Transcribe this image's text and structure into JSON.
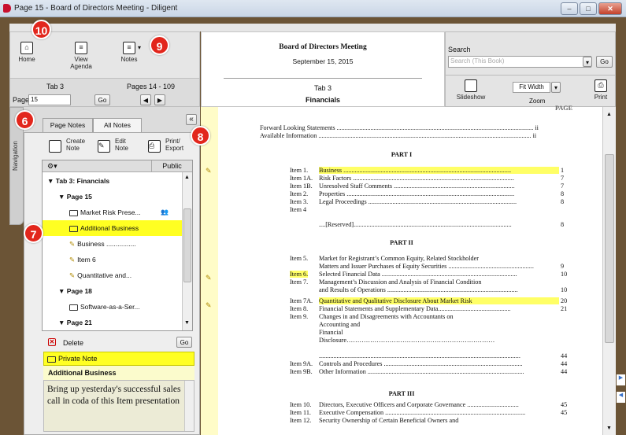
{
  "window": {
    "title": "Page 15 - Board of Directors Meeting - Diligent",
    "controls": [
      "–",
      "□",
      "✕"
    ]
  },
  "toolbar": {
    "home": "Home",
    "view_agenda_1": "View",
    "view_agenda_2": "Agenda",
    "notes": "Notes"
  },
  "nav": {
    "tab": "Tab 3",
    "pages": "Pages 14 - 109",
    "page_label": "Page:",
    "page_value": "15",
    "go": "Go"
  },
  "header": {
    "meeting": "Board of Directors Meeting",
    "date": "September 15, 2015",
    "tab": "Tab 3",
    "section": "Financials"
  },
  "search": {
    "label": "Search",
    "placeholder": "Search (This Book)",
    "go": "Go"
  },
  "view": {
    "slideshow": "Slideshow",
    "zoom_value": "Fit Width",
    "zoom": "Zoom",
    "print": "Print"
  },
  "side": {
    "navigation": "Navigation"
  },
  "tabs": {
    "page_notes": "Page Notes",
    "all_notes": "All Notes"
  },
  "actions": {
    "create_1": "Create",
    "create_2": "Note",
    "edit_1": "Edit",
    "edit_2": "Note",
    "print_1": "Print/",
    "print_2": "Export"
  },
  "tree": {
    "col_public": "Public",
    "rows": [
      {
        "label": "Tab 3: Financials",
        "type": "group"
      },
      {
        "label": "Page 15",
        "type": "page"
      },
      {
        "label": "Market Risk Prese...",
        "type": "note"
      },
      {
        "label": "Additional Business",
        "type": "note-hl"
      },
      {
        "label": "Business ................",
        "type": "mark"
      },
      {
        "label": "Item 6",
        "type": "mark"
      },
      {
        "label": "Quantitative and...",
        "type": "mark"
      },
      {
        "label": "Page 18",
        "type": "page"
      },
      {
        "label": "Software-as-a-Ser...",
        "type": "note"
      },
      {
        "label": "Page 21",
        "type": "page"
      }
    ]
  },
  "note": {
    "delete": "Delete",
    "go": "Go",
    "kind": "Private Note",
    "title": "Additional Business",
    "body": "Bring up yesterday's successful sales call in coda of this Item presentation"
  },
  "callouts": {
    "c10": "10",
    "c9": "9",
    "c6": "6",
    "c8": "8",
    "c7": "7"
  },
  "doc": {
    "top": "PAGE",
    "fls": "Forward Looking Statements .......................................................................................................................... ii",
    "ai": "Available Information .................................................................................................................................... ii",
    "part1": "PART I",
    "part2": "PART II",
    "part3": "PART III",
    "items": [
      {
        "n": "Item 1.",
        "t": "Business ........................................................................................................",
        "p": "1",
        "hl": true
      },
      {
        "n": "Item 1A.",
        "t": "Risk Factors ....................................................................................................",
        "p": "7"
      },
      {
        "n": "Item 1B.",
        "t": "Unresolved Staff Comments ...........................................................................",
        "p": "7"
      },
      {
        "n": "Item 2.",
        "t": "Properties ........................................................................................................",
        "p": "8"
      },
      {
        "n": "Item 3.",
        "t": "Legal Proceedings ............................................................................................",
        "p": "8"
      },
      {
        "n": "Item 4",
        "t": "",
        "p": ""
      },
      {
        "n": "",
        "t": "....[Reserved]..................................................................................................",
        "p": "8"
      },
      {
        "n": "Item 5.",
        "t": "Market for Registrant’s Common Equity, Related Stockholder",
        "p": ""
      },
      {
        "n": "",
        "t": "Matters and Issuer Purchases of Equity Securities .....................................................",
        "p": "9"
      },
      {
        "n": "Item 6.",
        "t": "Selected Financial Data ....................................................................................",
        "p": "10",
        "hlnum": true
      },
      {
        "n": "Item 7.",
        "t": "Management’s Discussion and Analysis of Financial Condition",
        "p": ""
      },
      {
        "n": "",
        "t": "and Results of Operations .................................................................................",
        "p": "10"
      },
      {
        "n": "Item 7A.",
        "t": "Quantitative and Qualitative Disclosure About Market Risk",
        "p": "20",
        "hl": true
      },
      {
        "n": "Item 8.",
        "t": "Financial Statements and Supplementary Data.............................................",
        "p": "21"
      },
      {
        "n": "Item 9.",
        "t": "Changes in and Disagreements with Accountants on",
        "p": ""
      },
      {
        "n": "",
        "t": "Accounting and",
        "p": ""
      },
      {
        "n": "",
        "t": "Financial",
        "p": ""
      },
      {
        "n": "",
        "t": "Disclosure……………………………………………………………",
        "p": ""
      },
      {
        "n": "",
        "t": ".............................................................................................................................",
        "p": "44"
      },
      {
        "n": "Item 9A.",
        "t": "Controls and Procedures ......................................................................................",
        "p": "44"
      },
      {
        "n": "Item 9B.",
        "t": "Other Information .................................................................................................",
        "p": "44"
      },
      {
        "n": "Item 10.",
        "t": "Directors, Executive Officers and Corporate Governance ................................",
        "p": "45"
      },
      {
        "n": "Item 11.",
        "t": "Executive Compensation .......................................................................................",
        "p": "45"
      },
      {
        "n": "Item 12.",
        "t": "Security Ownership of Certain Beneficial Owners and",
        "p": ""
      }
    ]
  }
}
